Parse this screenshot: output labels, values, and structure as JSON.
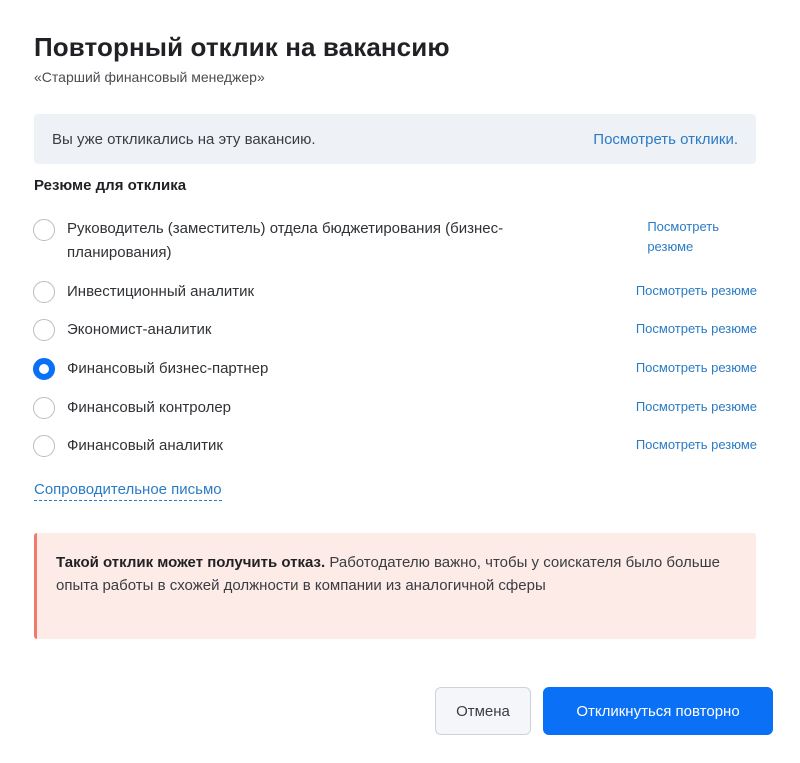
{
  "dialog": {
    "title": "Повторный отклик на вакансию",
    "subtitle": "«Старший финансовый менеджер»"
  },
  "notice": {
    "text": "Вы уже откликались на эту вакансию.",
    "link": "Посмотреть отклики."
  },
  "resumes": {
    "label": "Резюме для отклика",
    "items": [
      {
        "line1": "Руководитель (заместитель) отдела бюджетирования (бизнес-",
        "line2": "планирования)",
        "link1": "Посмотреть",
        "link2": "резюме",
        "checked": false
      },
      {
        "line1": "Инвестиционный аналитик",
        "link1": "Посмотреть резюме",
        "checked": false
      },
      {
        "line1": "Экономист-аналитик",
        "link1": "Посмотреть резюме",
        "checked": false
      },
      {
        "line1": "Финансовый бизнес-партнер",
        "link1": "Посмотреть резюме",
        "checked": true
      },
      {
        "line1": "Финансовый контролер",
        "link1": "Посмотреть резюме",
        "checked": false
      },
      {
        "line1": "Финансовый аналитик",
        "link1": "Посмотреть резюме",
        "checked": false
      }
    ]
  },
  "cover_letter": "Сопроводительное письмо",
  "warning": {
    "bold": "Такой отклик может получить отказ.",
    "text": " Работодателю важно, чтобы у соискателя было больше опыта работы в схожей должности в компании из аналогичной сферы"
  },
  "buttons": {
    "cancel": "Отмена",
    "submit": "Откликнуться повторно"
  },
  "colors": {
    "accent": "#0a70f5",
    "link": "#2b7bc4",
    "warning_bg": "#fcebe7",
    "warning_border": "#f07b6b",
    "notice_bg": "#eef1f6"
  }
}
